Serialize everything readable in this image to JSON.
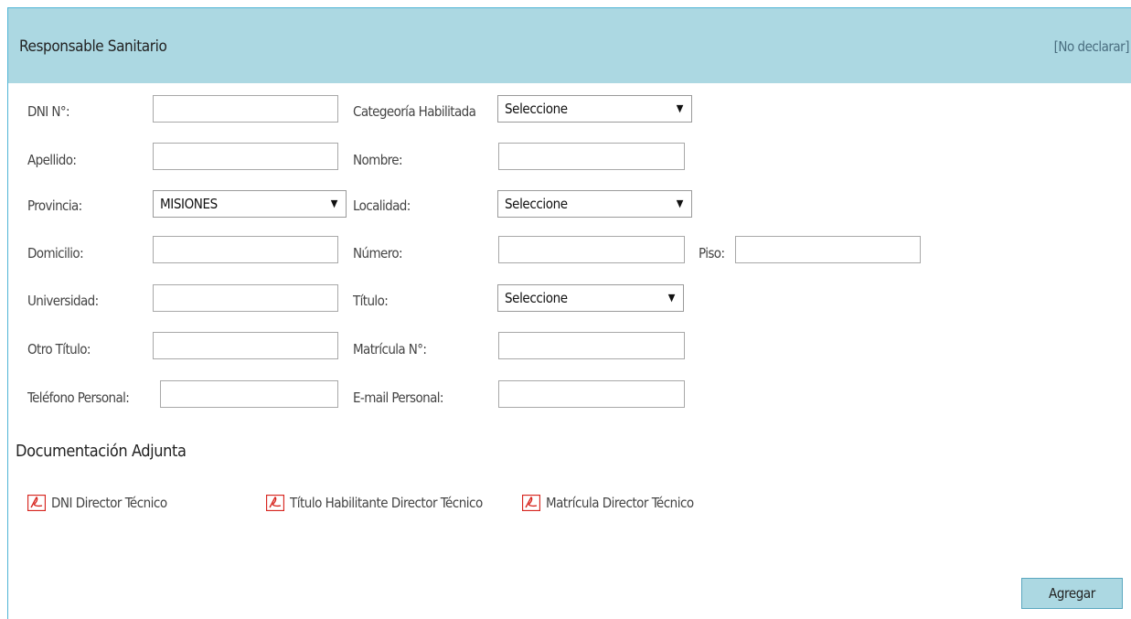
{
  "header": {
    "title": "Responsable Sanitario",
    "no_declarar": "[No declarar]"
  },
  "form": {
    "dni_label": "DNI N°:",
    "dni_value": "",
    "categoria_label": "Categeoría Habilitada",
    "categoria_selected": "Seleccione",
    "apellido_label": "Apellido:",
    "apellido_value": "",
    "nombre_label": "Nombre:",
    "nombre_value": "",
    "provincia_label": "Provincia:",
    "provincia_selected": "MISIONES",
    "localidad_label": "Localidad:",
    "localidad_selected": "Seleccione",
    "domicilio_label": "Domicilio:",
    "domicilio_value": "",
    "numero_label": "Número:",
    "numero_value": "",
    "piso_label": "Piso:",
    "piso_value": "",
    "universidad_label": "Universidad:",
    "universidad_value": "",
    "titulo_label": "Título:",
    "titulo_selected": "Seleccione",
    "otro_titulo_label": "Otro Título:",
    "otro_titulo_value": "",
    "matricula_label": "Matrícula N°:",
    "matricula_value": "",
    "telefono_label": "Teléfono Personal:",
    "telefono_value": "",
    "email_label": "E-mail Personal:",
    "email_value": ""
  },
  "docs": {
    "title": "Documentación Adjunta",
    "items": [
      {
        "label": "DNI Director Técnico",
        "icon": "pdf-icon"
      },
      {
        "label": "Título Habilitante Director Técnico",
        "icon": "pdf-icon"
      },
      {
        "label": "Matrícula Director Técnico",
        "icon": "pdf-icon"
      }
    ]
  },
  "actions": {
    "agregar_label": "Agregar"
  },
  "colors": {
    "header_bg": "#acd8e2",
    "border": "#4fb5d6",
    "pdf_red": "#d7261f"
  }
}
